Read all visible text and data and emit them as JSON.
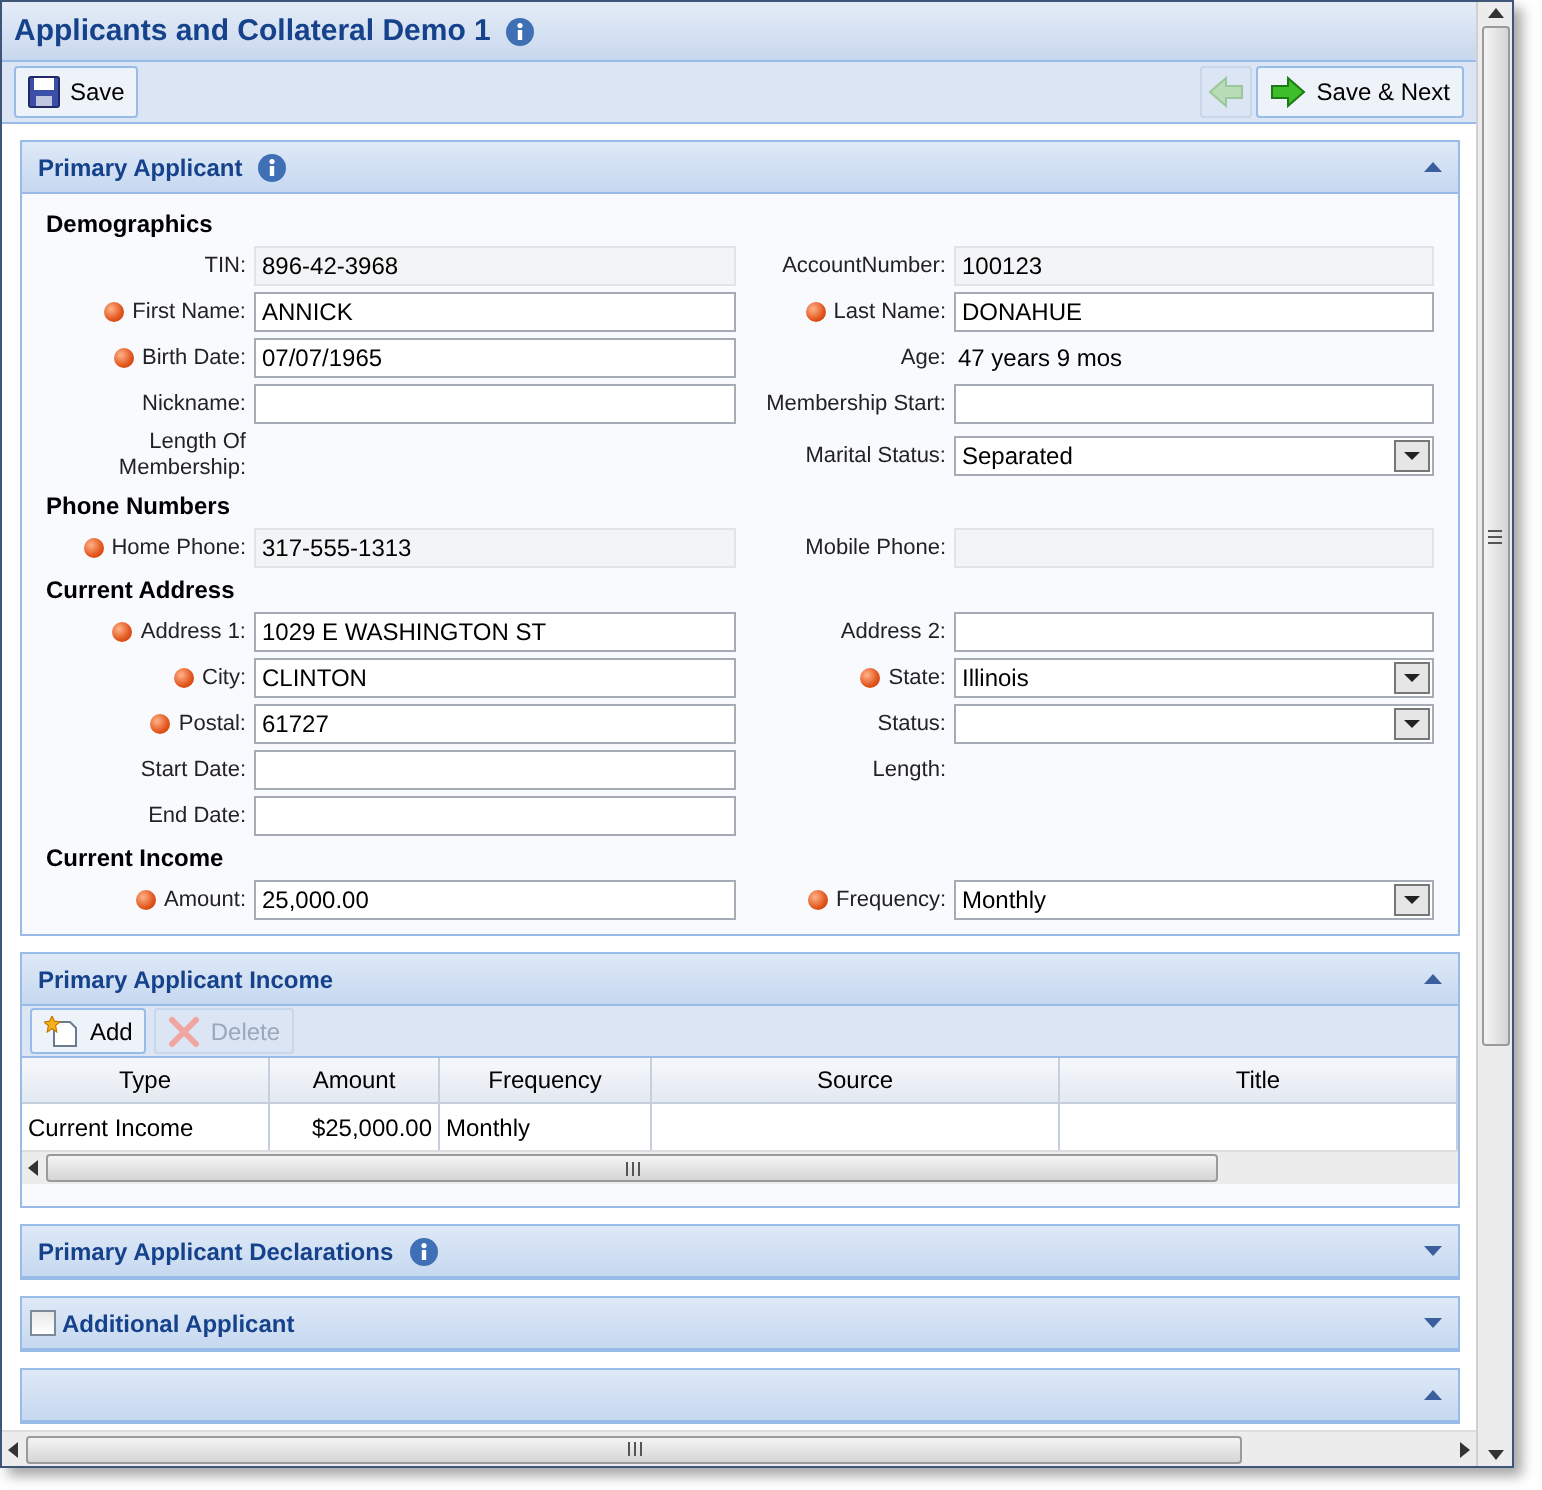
{
  "window": {
    "title": "Applicants and Collateral Demo 1",
    "info": true
  },
  "toolbar": {
    "save": {
      "label": "Save",
      "disabled": false
    },
    "previous": {
      "disabled": true
    },
    "save_next": {
      "label": "Save & Next",
      "disabled": false
    }
  },
  "primary_applicant": {
    "title": "Primary Applicant",
    "info": true,
    "expanded": true,
    "groups": [
      {
        "heading": "Demographics",
        "rows": [
          [
            {
              "label": "TIN:",
              "value": "896-42-3968",
              "kind": "readonly",
              "required": false
            },
            {
              "label": "AccountNumber:",
              "value": "100123",
              "kind": "readonly",
              "required": false
            }
          ],
          [
            {
              "label": "First Name:",
              "value": "ANNICK",
              "kind": "text",
              "required": true
            },
            {
              "label": "Last Name:",
              "value": "DONAHUE",
              "kind": "text",
              "required": true
            }
          ],
          [
            {
              "label": "Birth Date:",
              "value": "07/07/1965",
              "kind": "text",
              "required": true
            },
            {
              "label": "Age:",
              "value": "47 years 9 mos",
              "kind": "static",
              "required": false
            }
          ],
          [
            {
              "label": "Nickname:",
              "kind": "text",
              "required": false
            },
            {
              "label": "Membership Start:",
              "kind": "text",
              "required": false
            }
          ],
          [
            {
              "label": "Length Of Membership:",
              "kind": "static",
              "required": false
            },
            {
              "label": "Marital Status:",
              "value": "Separated",
              "kind": "select",
              "required": false
            }
          ]
        ]
      },
      {
        "heading": "Phone Numbers",
        "rows": [
          [
            {
              "label": "Home Phone:",
              "value": "317-555-1313",
              "kind": "readonly",
              "required": true
            },
            {
              "label": "Mobile Phone:",
              "kind": "readonly",
              "required": false
            }
          ]
        ]
      },
      {
        "heading": "Current Address",
        "rows": [
          [
            {
              "label": "Address 1:",
              "value": "1029 E WASHINGTON ST",
              "kind": "text",
              "required": true
            },
            {
              "label": "Address 2:",
              "kind": "text",
              "required": false
            }
          ],
          [
            {
              "label": "City:",
              "value": "CLINTON",
              "kind": "text",
              "required": true
            },
            {
              "label": "State:",
              "value": "Illinois",
              "kind": "select",
              "required": true
            }
          ],
          [
            {
              "label": "Postal:",
              "value": "61727",
              "kind": "text",
              "required": true
            },
            {
              "label": "Status:",
              "kind": "select",
              "required": false
            }
          ],
          [
            {
              "label": "Start Date:",
              "kind": "text",
              "required": false
            },
            {
              "label": "Length:",
              "kind": "static",
              "required": false
            }
          ],
          [
            {
              "label": "End Date:",
              "kind": "text",
              "required": false
            }
          ]
        ]
      },
      {
        "heading": "Current Income",
        "rows": [
          [
            {
              "label": "Amount:",
              "value": "25,000.00",
              "kind": "text",
              "required": true
            },
            {
              "label": "Frequency:",
              "value": "Monthly",
              "kind": "select",
              "required": true
            }
          ]
        ]
      }
    ]
  },
  "income": {
    "title": "Primary Applicant Income",
    "expanded": true,
    "buttons": [
      {
        "label": "Add",
        "kind": "add",
        "disabled": false
      },
      {
        "label": "Delete",
        "kind": "delete",
        "disabled": true
      }
    ],
    "columns": [
      "Type",
      "Amount",
      "Frequency",
      "Source",
      "Title"
    ],
    "rows": [
      [
        "Current Income",
        "$25,000.00",
        "Monthly",
        "",
        ""
      ]
    ]
  },
  "collapsed_sections": [
    {
      "title": "Primary Applicant Declarations",
      "info": true,
      "expanded": false
    },
    {
      "title": "Additional Applicant",
      "checkbox": true,
      "checked": false,
      "expanded": false
    },
    {
      "expanded": true
    }
  ]
}
